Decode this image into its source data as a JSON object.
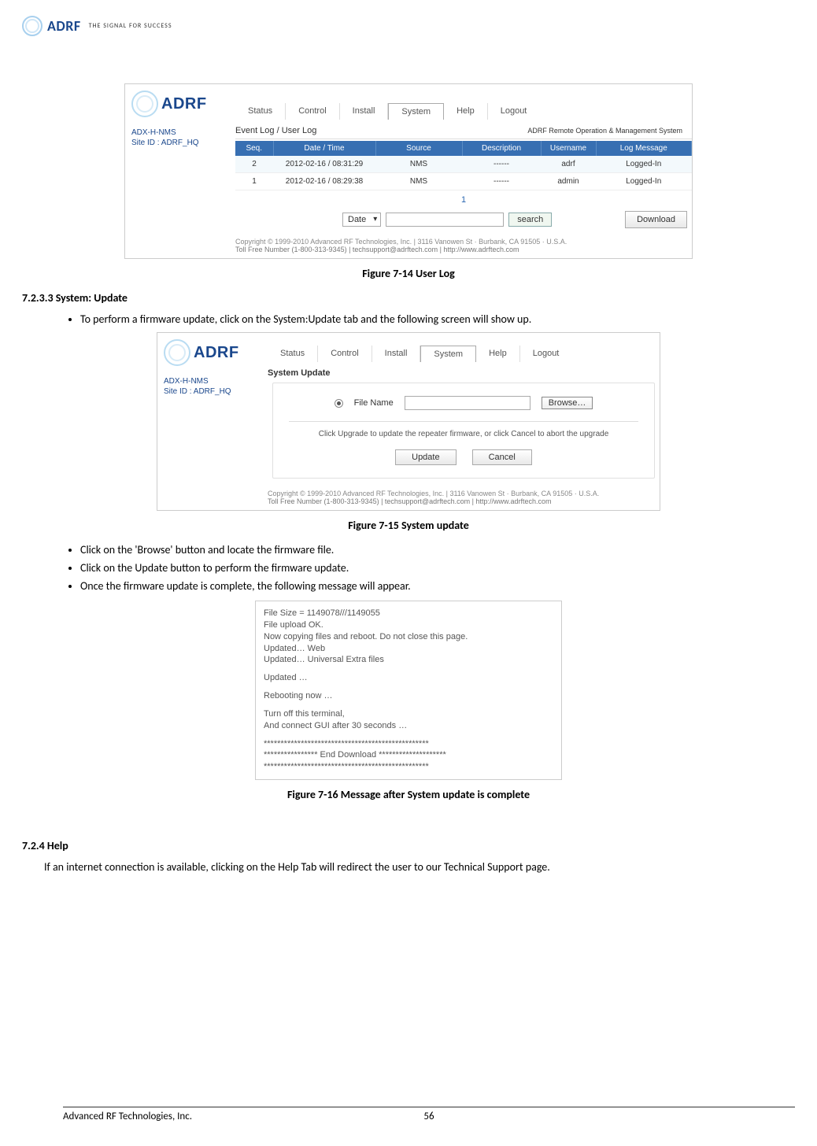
{
  "logo": {
    "brand": "ADRF",
    "tagline": "THE SIGNAL FOR SUCCESS"
  },
  "fig14": {
    "caption": "Figure 7-14   User Log",
    "sidebar": {
      "line1": "ADX-H-NMS",
      "line2": "Site ID : ADRF_HQ",
      "brand": "ADRF"
    },
    "tabs": [
      "Status",
      "Control",
      "Install",
      "System",
      "Help",
      "Logout"
    ],
    "remote": "ADRF Remote Operation & Management System",
    "section": "Event Log / User Log",
    "headers": [
      "Seq.",
      "Date / Time",
      "Source",
      "Description",
      "Username",
      "Log Message"
    ],
    "rows": [
      {
        "seq": "2",
        "dt": "2012-02-16 / 08:31:29",
        "src": "NMS",
        "desc": "------",
        "user": "adrf",
        "msg": "Logged-In"
      },
      {
        "seq": "1",
        "dt": "2012-02-16 / 08:29:38",
        "src": "NMS",
        "desc": "------",
        "user": "admin",
        "msg": "Logged-In"
      }
    ],
    "pager": "1",
    "filter": "Date",
    "search": "search",
    "download": "Download",
    "copyright": "Copyright © 1999-2010 Advanced RF Technologies, Inc. | 3116 Vanowen St · Burbank, CA 91505 · U.S.A.",
    "toll": "Toll Free Number (1-800-313-9345) | techsupport@adrftech.com | http://www.adrftech.com"
  },
  "sec733": {
    "heading": "7.2.3.3   System: Update",
    "bullet1": "To perform a firmware update, click on the System:Update tab and the following screen will show up."
  },
  "fig15": {
    "caption": "Figure 7-15   System update",
    "sidebar": {
      "line1": "ADX-H-NMS",
      "line2": "Site ID : ADRF_HQ",
      "brand": "ADRF"
    },
    "tabs": [
      "Status",
      "Control",
      "Install",
      "System",
      "Help",
      "Logout"
    ],
    "section": "System Update",
    "file_label": "File Name",
    "browse": "Browse…",
    "note": "Click Upgrade to update the repeater firmware, or click Cancel to abort the upgrade",
    "update_btn": "Update",
    "cancel_btn": "Cancel",
    "copyright": "Copyright © 1999-2010 Advanced RF Technologies, Inc. | 3116 Vanowen St · Burbank, CA 91505 · U.S.A.",
    "toll": "Toll Free Number (1-800-313-9345) | techsupport@adrftech.com | http://www.adrftech.com"
  },
  "bullets2": [
    "Click on the 'Browse' button and locate the firmware file.",
    "Click on the Update button to perform the firmware update.",
    "Once the firmware update is complete, the following message will appear."
  ],
  "fig16": {
    "caption": "Figure 7-16   Message after System update is complete",
    "lines": [
      "File Size = 1149078///1149055",
      "File upload OK.",
      "Now copying files and reboot. Do not close this page.",
      "Updated… Web",
      "Updated… Universal Extra files",
      "",
      "Updated …",
      "",
      "Rebooting now …",
      "",
      "Turn off this terminal,",
      "And connect GUI after 30 seconds …",
      "",
      "*************************************************",
      "**************** End Download ********************",
      "*************************************************"
    ]
  },
  "sec724": {
    "heading": "7.2.4      Help",
    "body": "If an internet connection is available, clicking on the Help Tab will redirect the user to our Technical Support page."
  },
  "footer": {
    "company": "Advanced RF Technologies, Inc.",
    "page": "56"
  }
}
